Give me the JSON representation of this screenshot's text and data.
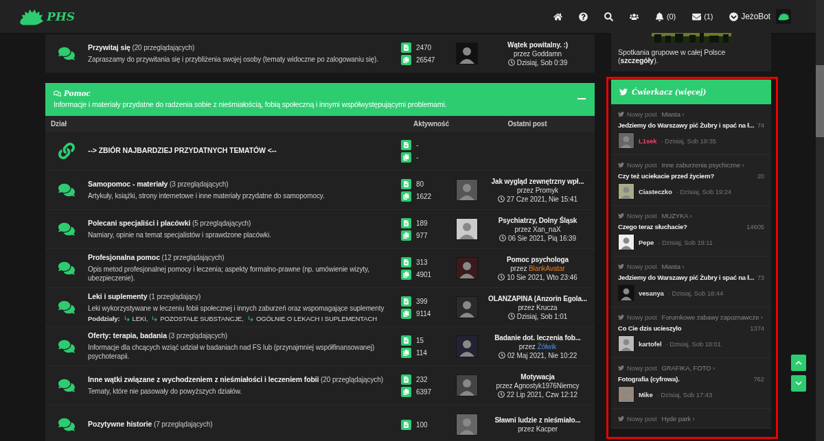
{
  "header": {
    "logo": "PHS",
    "nav": [
      {
        "kind": "home"
      },
      {
        "kind": "help"
      },
      {
        "kind": "search"
      },
      {
        "kind": "members"
      },
      {
        "kind": "notifications",
        "count": "(0)"
      },
      {
        "kind": "messages",
        "count": "(1)"
      },
      {
        "kind": "user",
        "label": "JeżoBot"
      }
    ]
  },
  "top_forum": {
    "name": "Przywitaj się",
    "viewers": "(20 przeglądających)",
    "description": "Zapraszamy do przywitania się i przybliżenia swojej osoby (tematy widoczne po zalogowaniu się).",
    "topics": "2470",
    "posts": "26547",
    "last_post": {
      "title": "Wątek powitalny. :)",
      "by": "przez",
      "author": "Goddamn",
      "time": "Dzisiaj, Sob 0:39"
    }
  },
  "category": {
    "title": "Pomoc",
    "description": "Informacje i materiały przydatne do radzenia sobie z nieśmiałością, fobią społeczną i innymi współwystępującymi problemami.",
    "expanded": true,
    "columns": [
      "Dział",
      "Aktywność",
      "Ostatni post"
    ],
    "forums": [
      {
        "kind": "link",
        "name": "--> ZBIÓR NAJBARDZIEJ PRZYDATNYCH TEMATÓW <--",
        "topics": "-",
        "posts": "-"
      },
      {
        "kind": "forum",
        "name": "Samopomoc - materiały",
        "viewers": "(3 przeglądających)",
        "description": "Artykuły, książki, strony internetowe i inne materiały przydatne do samopomocy.",
        "topics": "80",
        "posts": "1622",
        "last_post": {
          "title": "Jak wygląd zewnętrzny wpł...",
          "by": "przez",
          "author": "Promyk",
          "time": "27 Cze 2021, Nie 15:41"
        }
      },
      {
        "kind": "forum",
        "name": "Polecani specjaliści i placówki",
        "viewers": "(5 przeglądających)",
        "description": "Namiary, opinie na temat specjalistów i sprawdzone placówki.",
        "topics": "189",
        "posts": "977",
        "last_post": {
          "title": "Psychiatrzy, Dolny Śląsk",
          "by": "przez",
          "author": "Xan_naX",
          "time": "06 Sie 2021, Pią 16:39"
        }
      },
      {
        "kind": "forum",
        "name": "Profesjonalna pomoc",
        "viewers": "(12 przeglądających)",
        "description": "Opis metod profesjonalnej pomocy i leczenia; aspekty formalno-prawne (np. umówienie wizyty, ubezpieczenie).",
        "topics": "313",
        "posts": "4901",
        "last_post": {
          "title": "Pomoc psychologa",
          "by": "przez",
          "author": "BlankAvatar",
          "color": "#e67e22",
          "time": "10 Sie 2021, Wto 23:46"
        }
      },
      {
        "kind": "forum",
        "name": "Leki i suplementy",
        "viewers": "(1 przeglądający)",
        "description": "Leki wykorzystywane w leczeniu fobii społecznej i innych zaburzeń oraz wspomagające suplementy",
        "subforums_label": "Poddziały:",
        "subforums": [
          "LEKI,",
          "POZOSTAŁE SUBSTANCJE,",
          "OGÓLNIE O LEKACH I SUPLEMENTACH"
        ],
        "topics": "399",
        "posts": "9114",
        "last_post": {
          "title": "OLANZAPINA (Anzorin Egola...",
          "by": "przez",
          "author": "Krucza",
          "time": "Dzisiaj, Sob 1:01"
        }
      },
      {
        "kind": "forum",
        "name": "Oferty: terapia, badania",
        "viewers": "(3 przeglądających)",
        "description": "Informacje dla chcących wziąć udział w badaniach nad FS lub (przynajmniej współfinansowanej) psychoterapii.",
        "topics": "15",
        "posts": "114",
        "last_post": {
          "title": "Badanie dot. leczenia fob...",
          "by": "przez",
          "author": "Żółwik",
          "color": "#4a90e2",
          "time": "02 Maj 2021, Nie 10:22"
        }
      },
      {
        "kind": "forum",
        "name": "Inne wątki związane z wychodzeniem z nieśmiałości i leczeniem fobii",
        "viewers": "(20 przeglądających)",
        "description": "Tematy, które nie pasowały do powyższych działów.",
        "topics": "232",
        "posts": "6397",
        "last_post": {
          "title": "Motywacja",
          "by": "przez",
          "author": "Agnostyk1976Niemcy",
          "time": "22 Lip 2021, Czw 12:12"
        }
      },
      {
        "kind": "forum",
        "name": "Pozytywne historie",
        "viewers": "(7 przeglądających)",
        "topics": "100",
        "last_post": {
          "title": "Sławni ludzie z nieśmiało...",
          "by": "przez",
          "author": "Kacper"
        }
      }
    ]
  },
  "sidebar": {
    "meetups": {
      "text": "Spotkania grupowe w całej Polsce (",
      "link": "szczegóły",
      "after": ")."
    },
    "feed": {
      "title": "Ćwierkacz (więcej)",
      "items": [
        {
          "label": "Nowy post",
          "forum": "Miasta ›",
          "title": "Jedziemy do Warszawy pić Żubry i spać na ł...",
          "count": "74",
          "author": "L1sek",
          "color": "#e8436b",
          "time": "· Dzisiaj, Sob 19:35"
        },
        {
          "label": "Nowy post",
          "forum": "Inne zaburzenia psychiczne ›",
          "title": "Czy też uciekacie przed życiem?",
          "count": "20",
          "author": "Ciasteczko",
          "color": "#e0e0e0",
          "time": "· Dzisiaj, Sob 19:24"
        },
        {
          "label": "Nowy post",
          "forum": "MUZYKA ›",
          "title": "Czego teraz słuchacie?",
          "count": "14605",
          "author": "Pepe",
          "color": "#e0e0e0",
          "time": "· Dzisiaj, Sob 19:11"
        },
        {
          "label": "Nowy post",
          "forum": "Miasta ›",
          "title": "Jedziemy do Warszawy pić Żubry i spać na ł...",
          "count": "73",
          "author": "vesanya",
          "color": "#e0e0e0",
          "time": "· Dzisiaj, Sob 18:44"
        },
        {
          "label": "Nowy post",
          "forum": "Forumkowe zabawy zapoznawcze ›",
          "title": "Co Cie dzis ucieszylo",
          "count": "1374",
          "author": "kartofel",
          "color": "#e0e0e0",
          "time": "· Dzisiaj, Sob 18:01"
        },
        {
          "label": "Nowy post",
          "forum": "GRAFIKA, FOTO ›",
          "title": "Fotografia (cyfrowa).",
          "count": "762",
          "author": "Mike",
          "color": "#e0e0e0",
          "time": "· Dzisiaj, Sob 17:43"
        },
        {
          "label": "Nowy post",
          "forum": "Hyde park ›"
        }
      ]
    }
  }
}
